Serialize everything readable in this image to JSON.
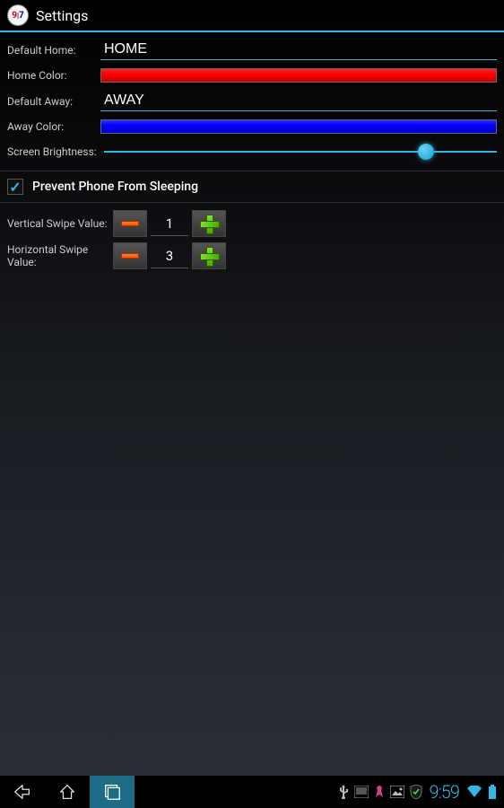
{
  "title": "Settings",
  "labels": {
    "defaultHome": "Default Home:",
    "homeColor": "Home Color:",
    "defaultAway": "Default Away:",
    "awayColor": "Away Color:",
    "screenBrightness": "Screen Brightness:",
    "preventSleep": "Prevent Phone From Sleeping",
    "verticalSwipe": "Vertical Swipe Value:",
    "horizontalSwipe": "Horizontal Swipe Value:"
  },
  "values": {
    "defaultHome": "HOME",
    "defaultAway": "AWAY",
    "homeColor": "#ff0000",
    "awayColor": "#0000ff",
    "brightnessPercent": 84,
    "preventSleepChecked": true,
    "verticalSwipe": "1",
    "horizontalSwipe": "3"
  },
  "statusBar": {
    "time": "9:59"
  }
}
